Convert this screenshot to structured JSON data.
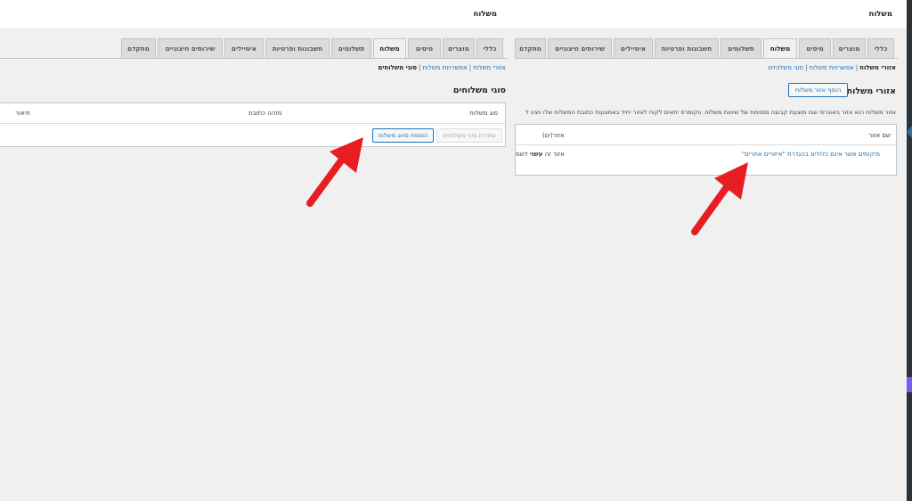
{
  "colors": {
    "accent": "#2271b1",
    "arrow": "#e61e24",
    "purple_marker": "#7b5cf0",
    "dark_strip": "#2c3338"
  },
  "left_pane": {
    "title": "משלוח",
    "tabs": [
      "כללי",
      "מוצרים",
      "מיסים",
      "משלוח",
      "תשלומים",
      "חשבונות ופרטיות",
      "אימיילים",
      "שירותים חיצוניים",
      "מתקדם"
    ],
    "active_tab": "משלוח",
    "subnav": {
      "zones": "אזורי משלוח",
      "options": "אפשרויות משלוח",
      "classes": "סוגי משלוחים"
    },
    "heading": "סוגי משלוחים",
    "table": {
      "headers": [
        "סוג משלוח",
        "מזהה כתובת",
        "תיאור"
      ]
    },
    "buttons": {
      "save": "שמירת סוגי משלוחים",
      "add": "הוספת סיווג משלוח"
    }
  },
  "right_pane": {
    "title": "משלוח",
    "tabs": [
      "כללי",
      "מוצרים",
      "מיסים",
      "משלוח",
      "תשלומים",
      "חשבונות ופרטיות",
      "אימיילים",
      "שירותים חיצוניים",
      "מתקדם"
    ],
    "active_tab": "משלוח",
    "subnav": {
      "zones": "אזורי משלוח",
      "options": "אפשרויות משלוח",
      "classes": "סוגי משלוחים"
    },
    "heading": "אזורי משלוח",
    "add_button": "הוסף אזור משלוח",
    "description": "אזור משלוח הוא אזור גיאוגרפי שבו מוצעת קבוצה מסוימת של שיטות משלוח. ווקומרס יתאים לקוח לאזור יחיד באמצעות כתובת המשלוח שלו ויציג ל",
    "table": {
      "headers": [
        "שם אזור",
        "אזור(ים)"
      ]
    },
    "other_zones_link": "מיקומים אשר אינם כלולים בהגדרת \"איזורים אחרים\"",
    "other_zones_note_prefix": "אזור זה ",
    "other_zones_note_bold": "עשוי",
    "other_zones_note_suffix": " לשמ"
  }
}
